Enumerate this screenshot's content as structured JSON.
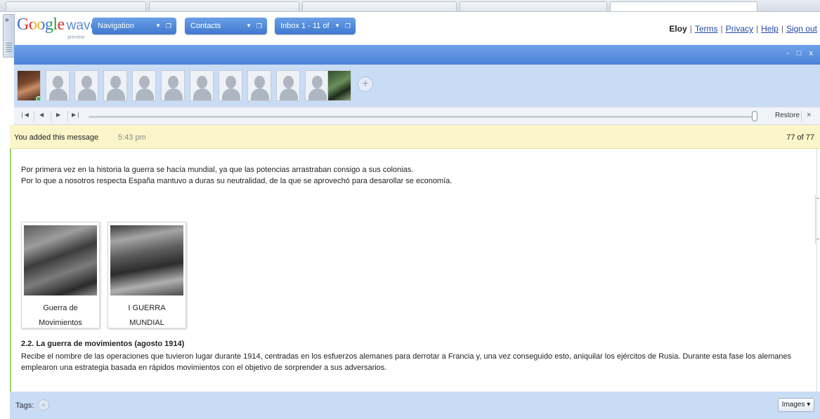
{
  "header": {
    "logo_google": "Google",
    "logo_wave": "wave",
    "logo_preview": "preview",
    "nav_pills": [
      {
        "label": "Navigation"
      },
      {
        "label": "Contacts"
      },
      {
        "label": "Inbox 1 - 11 of"
      }
    ],
    "user": {
      "name": "Eloy",
      "links": [
        "Terms",
        "Privacy",
        "Help",
        "Sign out"
      ]
    }
  },
  "window_controls": "- □ x",
  "participants": {
    "add_label": "+"
  },
  "playback": {
    "first": "❘◀",
    "prev": "◀",
    "next": "▶",
    "last": "▶❘",
    "restore_label": "Restore",
    "close_label": "×"
  },
  "blip": {
    "added_label": "You added this message",
    "time": "5:43 pm",
    "count": "77 of 77",
    "paragraphs": [
      "Por primera vez en la historia la guerra se hacía mundial, ya que las potencias arrastraban consigo a sus colonias.",
      "Por lo que a nosotros respecta España mantuvo a duras su neutralidad, de la que se aprovechó para desarollar se economía."
    ],
    "images": [
      {
        "caption_line1": "Guerra de",
        "caption_line2": "Movimientos"
      },
      {
        "caption_line1": "I GUERRA",
        "caption_line2": "MUNDIAL"
      }
    ],
    "section_title": "2.2. La guerra de movimientos (agosto 1914)",
    "body_lines": [
      "Recibe el nombre de las operaciones que tuvieron lugar durante 1914, centradas en los esfuerzos alemanes  para derrotar a Francia y, una vez conseguido esto, aniquilar los ejércitos de Rusia. Durante esta fase los alemanes",
      "emplearon una estrategia basada en rápidos movimientos con el objetivo de sorprender a sus adversarios."
    ]
  },
  "tags": {
    "label": "Tags:",
    "add": "+",
    "images_button": "Images ▾"
  }
}
